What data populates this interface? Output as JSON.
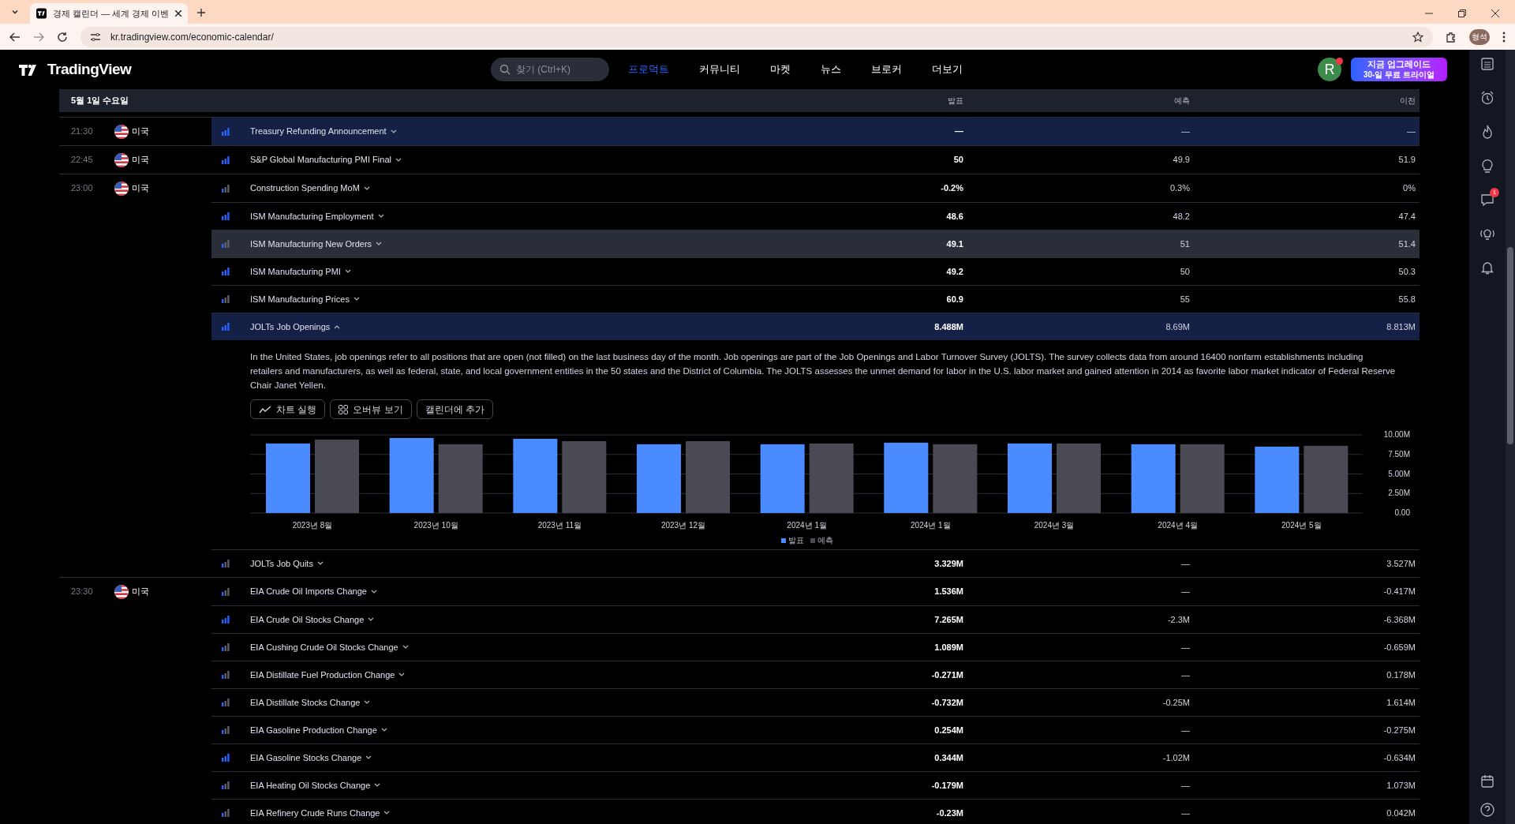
{
  "browser": {
    "tab_title": "경제 캘린더 — 세계 경제 이벤",
    "url": "kr.tradingview.com/economic-calendar/",
    "profile": "형석"
  },
  "header": {
    "logo": "TradingView",
    "search": {
      "placeholder": "찾기 (Ctrl+K)"
    },
    "nav": [
      {
        "label": "프로덕트",
        "selected": true
      },
      {
        "label": "커뮤니티",
        "selected": false
      },
      {
        "label": "마켓",
        "selected": false
      },
      {
        "label": "뉴스",
        "selected": false
      },
      {
        "label": "브로커",
        "selected": false
      },
      {
        "label": "더보기",
        "selected": false
      }
    ],
    "avatar": "R",
    "upgrade": {
      "title": "지금 업그레이드",
      "subtitle": "30-일 무료 트라이얼"
    }
  },
  "calendar": {
    "date": "5월 1일 수요일",
    "columns": [
      "발표",
      "예측",
      "이전"
    ],
    "groups": [
      {
        "time": "21:30",
        "country": "미국",
        "events": [
          {
            "name": "Treasury Refunding Announcement",
            "actual": "—",
            "forecast": "—",
            "previous": "—",
            "high_importance": true,
            "selected": true,
            "hovered": false,
            "expanded": false
          }
        ]
      },
      {
        "time": "22:45",
        "country": "미국",
        "events": [
          {
            "name": "S&P Global Manufacturing PMI Final",
            "actual": "50",
            "forecast": "49.9",
            "previous": "51.9",
            "high_importance": true,
            "selected": false,
            "hovered": false,
            "expanded": false
          }
        ]
      },
      {
        "time": "23:00",
        "country": "미국",
        "events": [
          {
            "name": "Construction Spending MoM",
            "actual": "-0.2%",
            "forecast": "0.3%",
            "previous": "0%",
            "high_importance": false,
            "selected": false,
            "hovered": false,
            "expanded": false
          },
          {
            "name": "ISM Manufacturing Employment",
            "actual": "48.6",
            "forecast": "48.2",
            "previous": "47.4",
            "high_importance": true,
            "selected": false,
            "hovered": false,
            "expanded": false
          },
          {
            "name": "ISM Manufacturing New Orders",
            "actual": "49.1",
            "forecast": "51",
            "previous": "51.4",
            "high_importance": false,
            "selected": false,
            "hovered": true,
            "expanded": false
          },
          {
            "name": "ISM Manufacturing PMI",
            "actual": "49.2",
            "forecast": "50",
            "previous": "50.3",
            "high_importance": true,
            "selected": false,
            "hovered": false,
            "expanded": false
          },
          {
            "name": "ISM Manufacturing Prices",
            "actual": "60.9",
            "forecast": "55",
            "previous": "55.8",
            "high_importance": false,
            "selected": false,
            "hovered": false,
            "expanded": false
          },
          {
            "name": "JOLTs Job Openings",
            "actual": "8.488M",
            "forecast": "8.69M",
            "previous": "8.813M",
            "high_importance": true,
            "selected": true,
            "hovered": false,
            "expanded": true,
            "details": {
              "description": "In the United States, job openings refer to all positions that are open (not filled) on the last business day of the month. Job openings are part of the Job Openings and Labor Turnover Survey (JOLTS). The survey collects data from around 16400 nonfarm establishments including retailers and manufacturers, as well as federal, state, and local government entities in the 50 states and the District of Columbia. The JOLTS assesses the unmet demand for labor in the U.S. labor market and gained attention in 2014 as favorite labor market indicator of Federal Reserve Chair Janet Yellen.",
              "buttons": [
                {
                  "label": "차트 실행"
                },
                {
                  "label": "오버뷰 보기"
                },
                {
                  "label": "캘린더에 추가"
                }
              ],
              "chart_data": {
                "type": "bar",
                "categories": [
                  "2023년 8월",
                  "2023년 10월",
                  "2023년 11월",
                  "2023년 12월",
                  "2024년 1월",
                  "2024년 1월",
                  "2024년 3월",
                  "2024년 4월",
                  "2024년 5월"
                ],
                "series": [
                  {
                    "name": "발표",
                    "color": "#4a8cff",
                    "values": [
                      8.9,
                      9.6,
                      9.5,
                      8.8,
                      8.8,
                      9.0,
                      8.9,
                      8.8,
                      8.5
                    ]
                  },
                  {
                    "name": "예측",
                    "color": "#4a4a55",
                    "values": [
                      9.4,
                      8.8,
                      9.2,
                      9.2,
                      8.9,
                      8.8,
                      8.9,
                      8.8,
                      8.6
                    ]
                  }
                ],
                "grid": true,
                "ylim": [
                  0,
                  10
                ],
                "yticks": [
                  {
                    "value": 0,
                    "label": "0.00"
                  },
                  {
                    "value": 2.5,
                    "label": "2.50M"
                  },
                  {
                    "value": 5,
                    "label": "5.00M"
                  },
                  {
                    "value": 7.5,
                    "label": "7.50M"
                  },
                  {
                    "value": 10,
                    "label": "10.00M"
                  }
                ]
              }
            }
          },
          {
            "name": "JOLTs Job Quits",
            "actual": "3.329M",
            "forecast": "—",
            "previous": "3.527M",
            "high_importance": false,
            "selected": false,
            "hovered": false,
            "expanded": false
          }
        ]
      },
      {
        "time": "23:30",
        "country": "미국",
        "events": [
          {
            "name": "EIA Crude Oil Imports Change",
            "actual": "1.536M",
            "forecast": "—",
            "previous": "-0.417M",
            "high_importance": false,
            "selected": false,
            "hovered": false,
            "expanded": false
          },
          {
            "name": "EIA Crude Oil Stocks Change",
            "actual": "7.265M",
            "forecast": "-2.3M",
            "previous": "-6.368M",
            "high_importance": true,
            "selected": false,
            "hovered": false,
            "expanded": false
          },
          {
            "name": "EIA Cushing Crude Oil Stocks Change",
            "actual": "1.089M",
            "forecast": "—",
            "previous": "-0.659M",
            "high_importance": false,
            "selected": false,
            "hovered": false,
            "expanded": false
          },
          {
            "name": "EIA Distillate Fuel Production Change",
            "actual": "-0.271M",
            "forecast": "—",
            "previous": "0.178M",
            "high_importance": false,
            "selected": false,
            "hovered": false,
            "expanded": false
          },
          {
            "name": "EIA Distillate Stocks Change",
            "actual": "-0.732M",
            "forecast": "-0.25M",
            "previous": "1.614M",
            "high_importance": false,
            "selected": false,
            "hovered": false,
            "expanded": false
          },
          {
            "name": "EIA Gasoline Production Change",
            "actual": "0.254M",
            "forecast": "—",
            "previous": "-0.275M",
            "high_importance": false,
            "selected": false,
            "hovered": false,
            "expanded": false
          },
          {
            "name": "EIA Gasoline Stocks Change",
            "actual": "0.344M",
            "forecast": "-1.02M",
            "previous": "-0.634M",
            "high_importance": true,
            "selected": false,
            "hovered": false,
            "expanded": false
          },
          {
            "name": "EIA Heating Oil Stocks Change",
            "actual": "-0.179M",
            "forecast": "—",
            "previous": "1.073M",
            "high_importance": false,
            "selected": false,
            "hovered": false,
            "expanded": false
          },
          {
            "name": "EIA Refinery Crude Runs Change",
            "actual": "-0.23M",
            "forecast": "—",
            "previous": "0.042M",
            "high_importance": false,
            "selected": false,
            "hovered": false,
            "expanded": false
          }
        ]
      }
    ]
  },
  "sidebar": {
    "chat_badge": "1"
  }
}
